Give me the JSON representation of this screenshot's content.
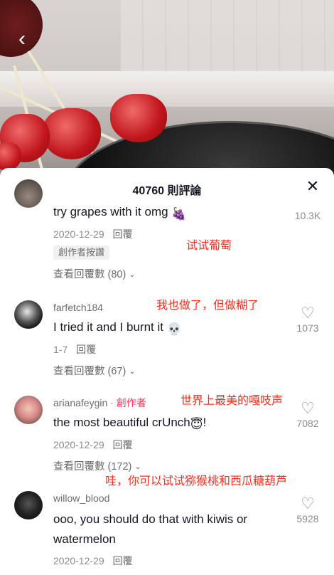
{
  "nav": {
    "back_icon": "chevron-left-icon",
    "back_glyph": "‹"
  },
  "sheet": {
    "title": "40760 則評論",
    "close_glyph": "✕"
  },
  "comments": [
    {
      "username": "",
      "text": "try grapes with it omg",
      "emoji": "🍇",
      "date": "2020-12-29",
      "reply_label": "回覆",
      "badge": "創作者按讚",
      "view_replies": "查看回覆數 (80)",
      "likes": "10.3K",
      "annotation": "试试葡萄"
    },
    {
      "username": "farfetch184",
      "text": "I tried it and I burnt it",
      "emoji": "💀",
      "date": "1-7",
      "reply_label": "回覆",
      "view_replies": "查看回覆數 (67)",
      "likes": "1073",
      "annotation": "我也做了，但做糊了"
    },
    {
      "username": "arianafeygin",
      "creator_tag": " · 創作者",
      "text": "the most beautiful crUnch",
      "emoji": "😇",
      "text_suffix": "!",
      "date": "2020-12-29",
      "reply_label": "回覆",
      "view_replies": "查看回覆數 (172)",
      "likes": "7082",
      "annotation": "世界上最美的嘎吱声"
    },
    {
      "username": "willow_blood",
      "text_line1": "ooo, you should do that with kiwis or",
      "text_line2": "watermelon",
      "date": "2020-12-29",
      "reply_label": "回覆",
      "likes": "5928",
      "annotation": "哇，你可以试试猕猴桃和西瓜糖葫芦"
    }
  ],
  "chevron_down": "⌄",
  "heart_glyph": "♡",
  "colors": {
    "accent": "#fe2c55",
    "annotation": "#ff2a1a",
    "text": "#161823",
    "muted": "#8a8b91"
  }
}
